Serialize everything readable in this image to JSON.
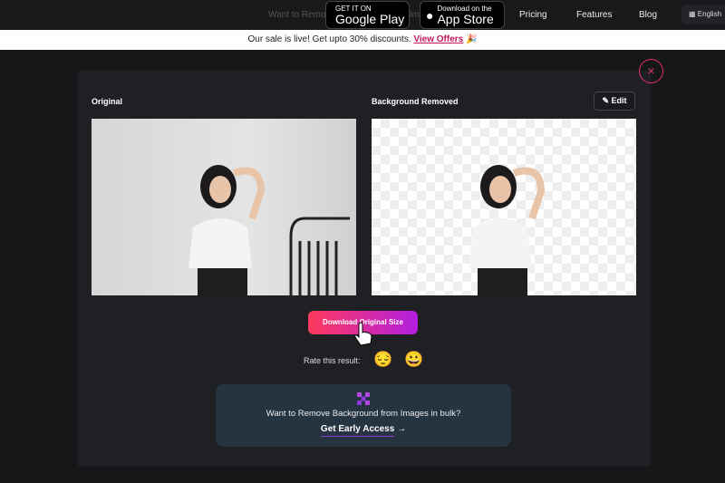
{
  "nav": {
    "ghost_text": "Want to Remove Background from Images",
    "google_play_small": "GET IT ON",
    "google_play_big": "Google Play",
    "app_store_small": "Download on the",
    "app_store_big": "App Store",
    "links": [
      "Pricing",
      "Features",
      "Blog"
    ],
    "language": "English"
  },
  "banner": {
    "text": "Our sale is live! Get upto 30% discounts.",
    "link": "View Offers",
    "emoji": "🎉"
  },
  "modal": {
    "close": "×",
    "original_label": "Original",
    "removed_label": "Background Removed",
    "edit_label": "Edit",
    "download_label": "Download Original Size",
    "rate_label": "Rate this result:",
    "emoji_bad": "😔",
    "emoji_good": "😀"
  },
  "bulk": {
    "text": "Want to Remove Background from Images in bulk?",
    "cta": "Get Early Access",
    "arrow": "→"
  },
  "colors": {
    "accent": "#e6326e",
    "gradient_start": "#ff3a5c",
    "gradient_end": "#b21ee0",
    "card": "#263340"
  }
}
